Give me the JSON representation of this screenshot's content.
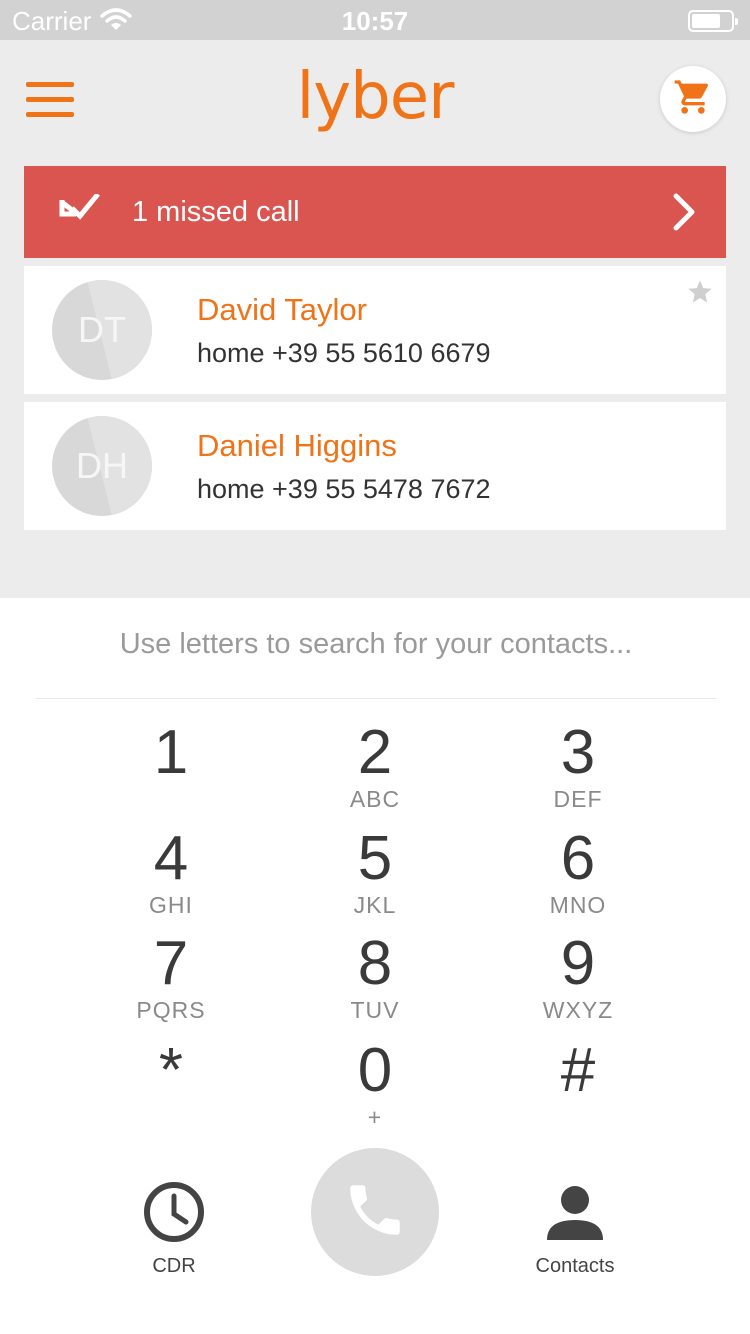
{
  "status_bar": {
    "carrier": "Carrier",
    "time": "10:57"
  },
  "header": {
    "brand": "lyber"
  },
  "missed_banner": {
    "text": "1 missed call"
  },
  "contacts": [
    {
      "initials": "DT",
      "name": "David Taylor",
      "phone": "home +39 55 5610 6679",
      "favorite": true
    },
    {
      "initials": "DH",
      "name": "Daniel Higgins",
      "phone": "home +39 55 5478 7672",
      "favorite": false
    }
  ],
  "dialer": {
    "search_hint": "Use letters to search for your contacts...",
    "keys": [
      {
        "digit": "1",
        "letters": ""
      },
      {
        "digit": "2",
        "letters": "ABC"
      },
      {
        "digit": "3",
        "letters": "DEF"
      },
      {
        "digit": "4",
        "letters": "GHI"
      },
      {
        "digit": "5",
        "letters": "JKL"
      },
      {
        "digit": "6",
        "letters": "MNO"
      },
      {
        "digit": "7",
        "letters": "PQRS"
      },
      {
        "digit": "8",
        "letters": "TUV"
      },
      {
        "digit": "9",
        "letters": "WXYZ"
      },
      {
        "digit": "*",
        "letters": ""
      },
      {
        "digit": "0",
        "letters": "+"
      },
      {
        "digit": "#",
        "letters": ""
      }
    ]
  },
  "bottom_bar": {
    "cdr_label": "CDR",
    "contacts_label": "Contacts"
  },
  "colors": {
    "accent": "#f07318",
    "missed": "#da5450",
    "header_bg": "#ececec"
  }
}
